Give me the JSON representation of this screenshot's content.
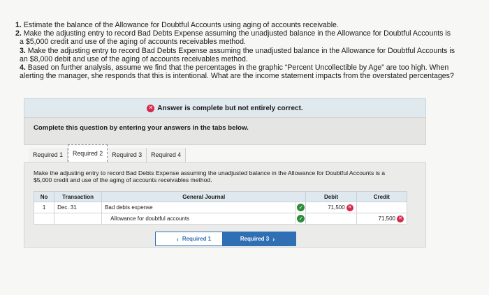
{
  "instructions": [
    {
      "num": "1.",
      "text": " Estimate the balance of the Allowance for Doubtful Accounts using aging of accounts receivable."
    },
    {
      "num": "2.",
      "text": " Make the adjusting entry to record Bad Debts Expense assuming the unadjusted balance in the Allowance for Doubtful Accounts is"
    },
    {
      "num": "",
      "text": "a $5,000 credit and use of the aging of accounts receivables method."
    },
    {
      "num": "3.",
      "text": " Make the adjusting entry to record Bad Debts Expense assuming the unadjusted balance in the Allowance for Doubtful Accounts is"
    },
    {
      "num": "",
      "text": "an $8,000 debit and use of the aging of accounts receivables method."
    },
    {
      "num": "4.",
      "text": " Based on further analysis, assume we find that the percentages in the graphic “Percent Uncollectible by Age” are too high. When"
    },
    {
      "num": "",
      "text": "alerting the manager, she responds that this is intentional. What are the income statement impacts from the overstated percentages?"
    }
  ],
  "banner": {
    "text": "Answer is complete but not entirely correct.",
    "icon": "x-circle-icon",
    "color": "#d6284a"
  },
  "panel_instruction": "Complete this question by entering your answers in the tabs below.",
  "tabs": [
    {
      "label": "Required 1"
    },
    {
      "label": "Required 2"
    },
    {
      "label": "Required 3"
    },
    {
      "label": "Required 4"
    }
  ],
  "prompt": "Make the adjusting entry to record Bad Debts Expense assuming the unadjusted balance in the Allowance for Doubtful Accounts is a $5,000 credit and use of the aging of accounts receivables method.",
  "journal": {
    "title": "General Journal",
    "headers": {
      "no": "No",
      "transaction": "Transaction",
      "debit": "Debit",
      "credit": "Credit"
    },
    "rows": [
      {
        "no": "1",
        "transaction": "Dec. 31",
        "account": "Bad debts expense",
        "debit": "71,500",
        "credit": ""
      },
      {
        "no": "",
        "transaction": "",
        "account": "Allowance for doubtful accounts",
        "debit": "",
        "credit": "71,500"
      }
    ]
  },
  "nav": {
    "prev_label": "Required 1",
    "next_label": "Required 3",
    "accent": "#2f6fb3"
  }
}
